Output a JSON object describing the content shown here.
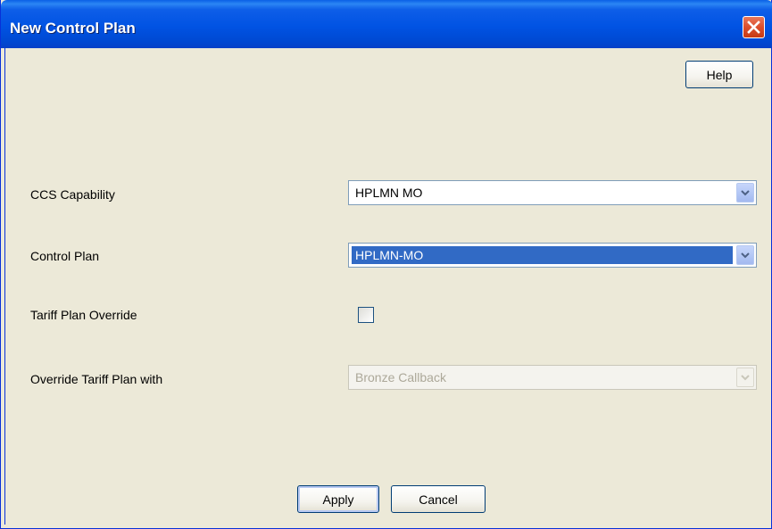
{
  "window": {
    "title": "New Control Plan"
  },
  "buttons": {
    "help_label": "Help",
    "apply_label": "Apply",
    "cancel_label": "Cancel"
  },
  "form": {
    "ccs_capability": {
      "label": "CCS Capability",
      "value": "HPLMN MO"
    },
    "control_plan": {
      "label": "Control Plan",
      "value": "HPLMN-MO"
    },
    "tariff_plan_override": {
      "label": "Tariff Plan Override",
      "checked": false
    },
    "override_tariff_plan_with": {
      "label": "Override Tariff Plan with",
      "value": "Bronze Callback",
      "disabled": true
    }
  },
  "icons": {
    "close": "close-icon",
    "dropdown": "chevron-down-icon"
  },
  "colors": {
    "titlebar": "#0153e3",
    "window_bg": "#ece9d8",
    "selection": "#316ac5",
    "close_button": "#dc4e2c"
  }
}
